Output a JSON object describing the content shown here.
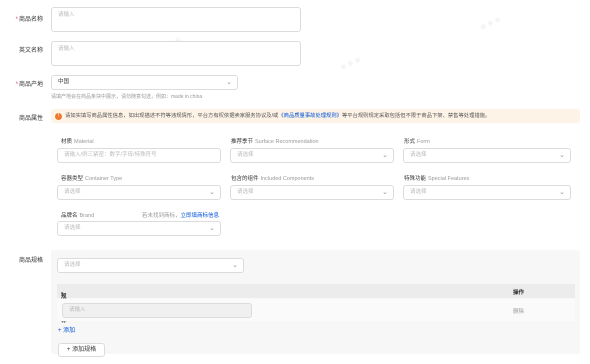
{
  "form": {
    "product_name": {
      "label": "商品名称",
      "required": true,
      "placeholder": "请输入"
    },
    "english_name": {
      "label": "英文名称",
      "required": false,
      "placeholder": "请输入"
    },
    "origin": {
      "label": "商品产地",
      "required": true,
      "value": "中国",
      "hint": "请填产地会在商品条块中展示，请勿随意勾选，例如：made in china"
    },
    "attributes": {
      "label": "商品属性",
      "alert_text": "请如实填写商品属性信息，如出现描述不符等违规情形，平台方有权依据卖家服务协议及/或",
      "alert_link": "《商品质量事故处理规则》",
      "alert_tail": "等平台规则规定采取包括但不限于商品下架、禁售等处理措施。",
      "fields": [
        {
          "label": "材质",
          "en": "Material",
          "placeholder": "请输入/例三紧密：数字/字母/特殊符号"
        },
        {
          "label": "推荐季节",
          "en": "Surface Recommendation",
          "placeholder": "请选择"
        },
        {
          "label": "形式",
          "en": "Form",
          "placeholder": "请选择"
        },
        {
          "label": "容器类型",
          "en": "Container Type",
          "placeholder": "请选择"
        },
        {
          "label": "包含的组件",
          "en": "Included Components",
          "placeholder": "请选择"
        },
        {
          "label": "特殊功能",
          "en": "Special Features",
          "placeholder": "请选择"
        },
        {
          "label": "品牌名",
          "en": "Brand",
          "placeholder": "请选择"
        }
      ],
      "brand_hint": "若未找到商标，",
      "brand_link": "立即填商标信息"
    },
    "specs": {
      "label": "商品规格",
      "select_placeholder": "请选择",
      "col_name": "规格名称",
      "col_action": "操作",
      "row_placeholder": "请输入",
      "row_action": "删除",
      "add_link": "+ 添加",
      "add_button": "+ 添加规格"
    }
  },
  "colors": {
    "accent": "#0052d9",
    "warning": "#ed7b2f",
    "required": "#e34d59",
    "alert_bg": "#fdf3e7"
  }
}
